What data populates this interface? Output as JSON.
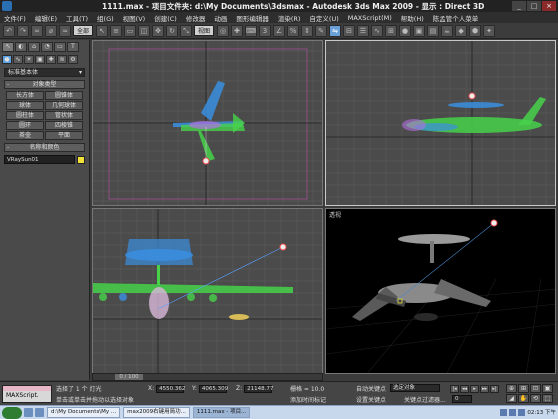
{
  "window": {
    "title": "1111.max  - 项目文件夹: d:\\My Documents\\3dsmax  - Autodesk 3ds Max  2009  - 显示 : Direct 3D",
    "buttons": [
      "_",
      "□",
      "×"
    ]
  },
  "menu": [
    "文件(F)",
    "编辑(E)",
    "工具(T)",
    "组(G)",
    "视图(V)",
    "创建(C)",
    "修改器",
    "动画",
    "图形编辑器",
    "渲染(R)",
    "自定义(U)",
    "MAXScript(M)",
    "帮助(H)",
    "陈孟管个人菜单"
  ],
  "toolbar": {
    "selection_filter": "全部",
    "ref_coord": "视图"
  },
  "command_panel": {
    "tabs": [
      "↖",
      "◐",
      "⌂",
      "◔",
      "▭",
      "T"
    ],
    "category_dropdown": "标准基本体",
    "object_type_header": "对象类型",
    "object_types": [
      "长方体",
      "圆锥体",
      "球体",
      "几何球体",
      "圆柱体",
      "管状体",
      "圆环",
      "四棱锥",
      "茶壶",
      "平面"
    ],
    "name_color_header": "名称和颜色",
    "object_name": "VRaySun01",
    "object_color": "#f2e23a"
  },
  "viewports": {
    "persp_label": "透视"
  },
  "time_slider": {
    "value": "0 / 100"
  },
  "status": {
    "maxscript_label": "MAXScript.",
    "selection": "选择了 1 个 灯光",
    "prompt": "单击或单击并拖动以选择对象",
    "coord_x_label": "X:",
    "coord_x": "4550.362",
    "coord_y_label": "Y:",
    "coord_y": "4065.309",
    "coord_z_label": "Z:",
    "coord_z": "21148.77",
    "grid": "栅格 = 10.0",
    "add_time_tag": "添加时间标记",
    "auto_key": "自动关键点",
    "selection_set": "选定对象",
    "set_key": "设置关键点",
    "key_filters": "关键点过滤器...",
    "current_frame": "0",
    "playback": [
      "|◂",
      "◂◂",
      "▸",
      "▸▸",
      "▸|"
    ]
  },
  "taskbar": {
    "tasks": [
      "d:\\My Documents\\My ...",
      "max2009右键用简功...",
      "1111.max  - 项目..."
    ],
    "clock": "02:13 下午"
  }
}
